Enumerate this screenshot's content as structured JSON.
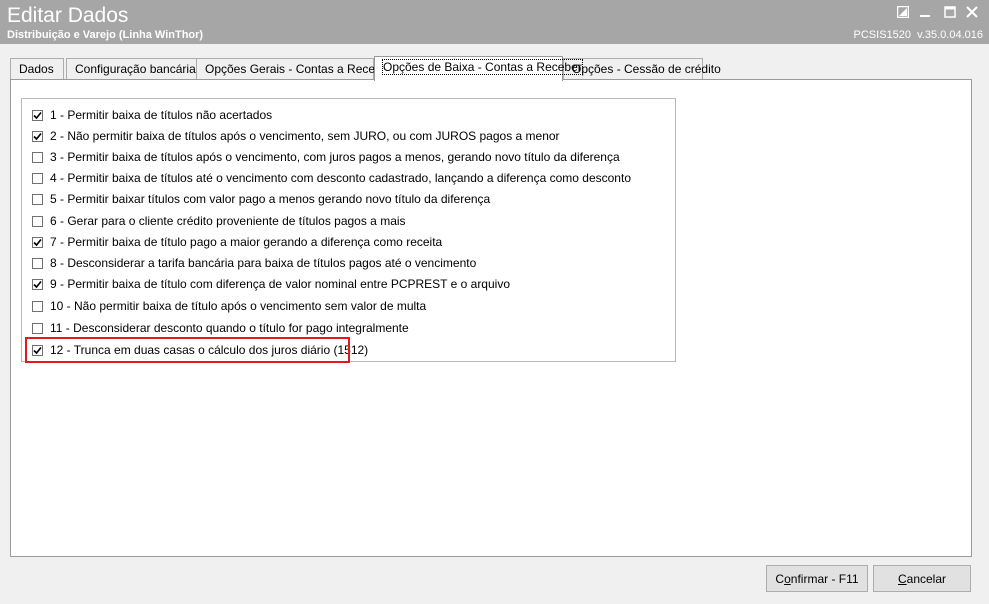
{
  "window": {
    "title": "Editar Dados",
    "subtitle": "Distribuição e Varejo (Linha WinThor)",
    "routine": "PCSIS1520",
    "version": "v.35.0.04.016",
    "titlebar_color": "#a6a6a6"
  },
  "tabs": [
    {
      "label": "Dados",
      "active": false
    },
    {
      "label": "Configuração bancária",
      "active": false
    },
    {
      "label": "Opções Gerais - Contas a Receber",
      "active": false
    },
    {
      "label": "Opções de Baixa - Contas a Receber",
      "active": true
    },
    {
      "label": "Opções - Cessão de crédito",
      "active": false
    }
  ],
  "options": [
    {
      "label": "1 - Permitir baixa de títulos não acertados",
      "checked": true
    },
    {
      "label": "2 - Não permitir baixa de títulos após o vencimento, sem JURO, ou com JUROS pagos a menor",
      "checked": true
    },
    {
      "label": "3 - Permitir baixa de títulos após o vencimento, com juros pagos a menos, gerando novo título da diferença",
      "checked": false
    },
    {
      "label": "4 - Permitir baixa de títulos até o vencimento com desconto cadastrado, lançando a diferença como desconto",
      "checked": false
    },
    {
      "label": "5 - Permitir baixar títulos com valor pago a menos gerando novo título da diferença",
      "checked": false
    },
    {
      "label": "6 - Gerar para o cliente crédito proveniente de títulos pagos a mais",
      "checked": false
    },
    {
      "label": "7 - Permitir baixa de título pago a maior gerando a diferença como receita",
      "checked": true
    },
    {
      "label": "8 - Desconsiderar a tarifa bancária para baixa de títulos pagos até o vencimento",
      "checked": false
    },
    {
      "label": "9 - Permitir baixa de título com diferença de valor nominal entre PCPREST e o arquivo",
      "checked": true
    },
    {
      "label": "10 - Não permitir baixa de título após o vencimento sem valor de multa",
      "checked": false
    },
    {
      "label": "11 - Desconsiderar desconto quando o título for pago integralmente",
      "checked": false
    },
    {
      "label": "12 - Trunca em duas casas o cálculo dos juros diário (1512)",
      "checked": true
    }
  ],
  "buttons": {
    "confirm_prefix": "C",
    "confirm_underlined": "o",
    "confirm_rest": "nfirmar - F11",
    "cancel_prefix": "",
    "cancel_underlined": "C",
    "cancel_rest": "ancelar"
  },
  "highlight_color": "#e11b1b"
}
